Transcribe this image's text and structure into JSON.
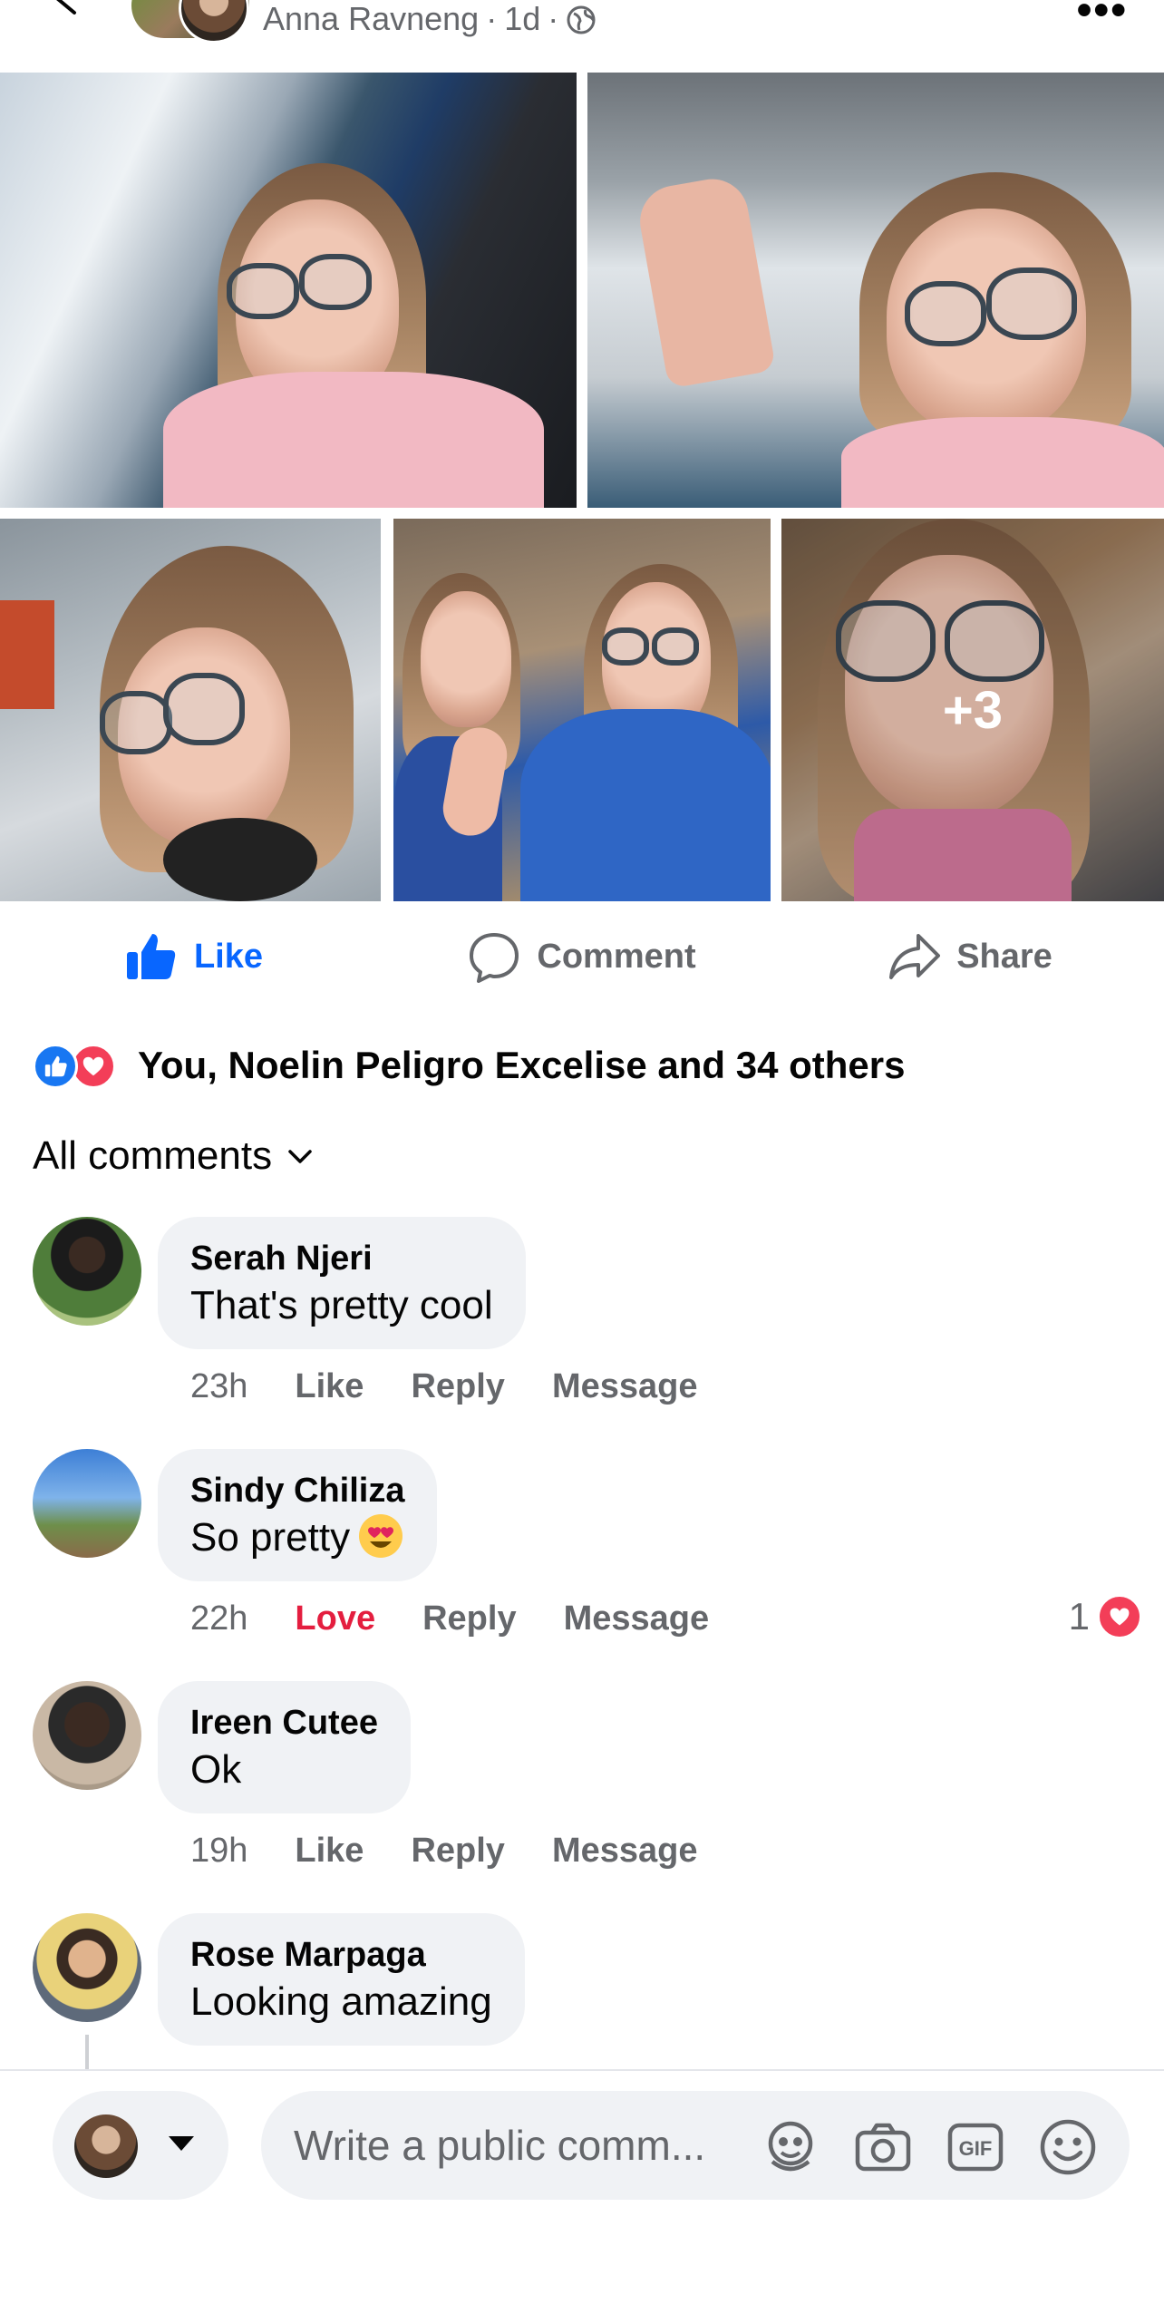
{
  "header": {
    "author": "Anna Ravneng",
    "time": "1d",
    "separator": "·",
    "audience_icon": "globe-icon",
    "more_icon": "more-icon"
  },
  "photos": {
    "overflow_label": "+3"
  },
  "actions": {
    "like": "Like",
    "comment": "Comment",
    "share": "Share"
  },
  "reactions": {
    "summary": "You, Noelin Peligro Excelise and 34 others",
    "icons": [
      "like-icon",
      "love-icon"
    ]
  },
  "filter": {
    "label": "All comments"
  },
  "comments": [
    {
      "name": "Serah Njeri",
      "text": "That's pretty cool",
      "time": "23h",
      "like": "Like",
      "reply": "Reply",
      "message": "Message"
    },
    {
      "name": "Sindy Chiliza",
      "text": "So pretty",
      "emoji": "heart-eyes-emoji",
      "time": "22h",
      "like": "Love",
      "reply": "Reply",
      "message": "Message",
      "reaction_count": "1"
    },
    {
      "name": "Ireen Cutee",
      "text": "Ok",
      "time": "19h",
      "like": "Like",
      "reply": "Reply",
      "message": "Message"
    },
    {
      "name": "Rose Marpaga",
      "text": "Looking amazing"
    }
  ],
  "composer": {
    "placeholder": "Write a public comm...",
    "tools": [
      "avatar-sticker-icon",
      "camera-icon",
      "gif-icon",
      "emoji-icon"
    ]
  },
  "colors": {
    "facebook_blue": "#0866ff",
    "love_red": "#e41e3f",
    "secondary_text": "#65676b",
    "bubble_bg": "#f0f2f5"
  }
}
